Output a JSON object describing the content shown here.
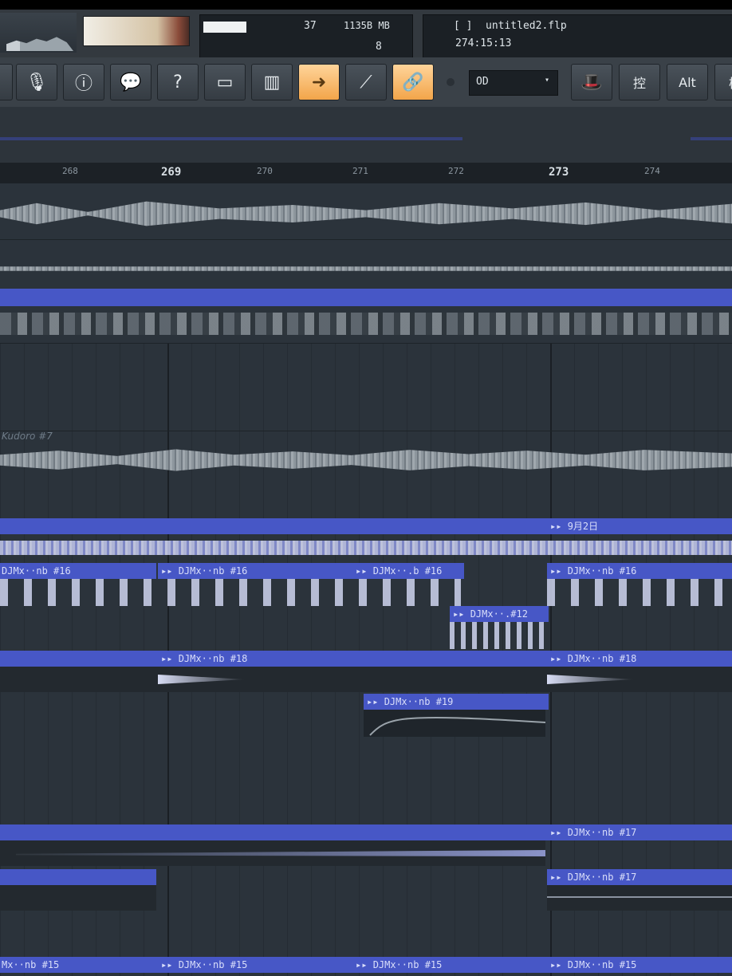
{
  "header": {
    "cpu_value": "37",
    "memory": "1135B MB",
    "polyphony": "8",
    "filename": "untitled2.flp",
    "song_time": "274:15:13",
    "bracket": "[ ]"
  },
  "toolbar": {
    "buttons": [
      {
        "name": "mic-icon",
        "glyph": "🎙"
      },
      {
        "name": "info-icon",
        "glyph": "ⓘ"
      },
      {
        "name": "speech-bubble-icon",
        "glyph": "💬"
      },
      {
        "name": "help-icon",
        "glyph": "?"
      },
      {
        "name": "window-icon",
        "glyph": "▭"
      },
      {
        "name": "keyboard-icon",
        "glyph": "▥"
      },
      {
        "name": "arrow-right-icon",
        "glyph": "➜",
        "active": true
      },
      {
        "name": "brush-icon",
        "glyph": "⟋"
      },
      {
        "name": "link-icon",
        "glyph": "🔗",
        "active": true
      }
    ],
    "lcd_label": "OD",
    "right_buttons": [
      {
        "name": "hat-icon",
        "glyph": "🎩"
      },
      {
        "name": "kanji-button",
        "label": "控"
      },
      {
        "name": "alt-button",
        "label": "Alt"
      },
      {
        "name": "kanji2-button",
        "label": "模"
      }
    ]
  },
  "ruler": {
    "ticks": [
      {
        "label": "268",
        "major": false
      },
      {
        "label": "269",
        "major": true
      },
      {
        "label": "270",
        "major": false
      },
      {
        "label": "271",
        "major": false
      },
      {
        "label": "272",
        "major": false
      },
      {
        "label": "273",
        "major": true
      },
      {
        "label": "274",
        "major": false
      }
    ]
  },
  "tracks": {
    "kudoro_label": "Kudoro #7",
    "date_clip": "9月2日",
    "clips": {
      "c16a": "DJMx··nb #16",
      "c16b": "DJMx··nb #16",
      "c16c": "DJMx··.b #16",
      "c16d": "DJMx··nb #16",
      "c12": "DJMx··.#12",
      "c18a": "DJMx··nb #18",
      "c18b": "DJMx··nb #18",
      "c19": "DJMx··nb #19",
      "c17a": "DJMx··nb #17",
      "c17b": "DJMx··nb #17",
      "c15a": "Mx··nb #15",
      "c15b": "DJMx··nb #15",
      "c15c": "DJMx··nb #15",
      "c15d": "DJMx··nb #15"
    },
    "c15_left": "Mx··nb #15"
  },
  "colors": {
    "clip": "#4757c6",
    "active_button": "#f2a54a",
    "background": "#2b333b"
  }
}
